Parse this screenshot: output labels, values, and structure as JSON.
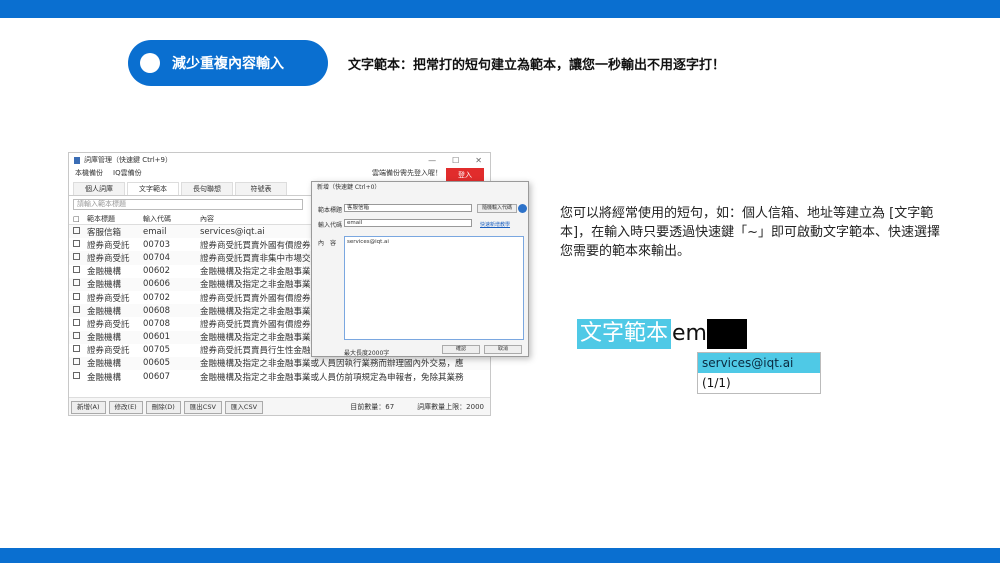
{
  "header": {
    "pill_label": "減少重複內容輸入",
    "headline": "文字範本：把常打的短句建立為範本，讓您一秒輸出不用逐字打！"
  },
  "description": "您可以將經常使用的短句，如：個人信箱、地址等建立為 [文字範本]，在輸入時只要透過快速鍵「~」即可啟動文字範本、快速選擇您需要的範本來輸出。",
  "main_window": {
    "title": "詞庫管理（快速鍵 Ctrl+9）",
    "menu": [
      "本機備份",
      "IQ雲備份"
    ],
    "notice": "雲端備份需先登入喔！",
    "login_label": "登入",
    "tabs": [
      "個人詞庫",
      "文字範本",
      "長句聯想",
      "符號表"
    ],
    "search_placeholder": "請輸入範本標題",
    "columns": [
      "範本標題",
      "輸入代碼",
      "內容"
    ],
    "rows": [
      {
        "title": "客服信箱",
        "code": "email",
        "content": "services@iqt.ai"
      },
      {
        "title": "證券商受託",
        "code": "00703",
        "content": "證券商受託買賣外國有價證券"
      },
      {
        "title": "證券商受託",
        "code": "00704",
        "content": "證券商受託買賣非集中市場交易"
      },
      {
        "title": "金融機構",
        "code": "00602",
        "content": "金融機構及指定之非金融事業"
      },
      {
        "title": "金融機構",
        "code": "00606",
        "content": "金融機構及指定之非金融事業"
      },
      {
        "title": "證券商受託",
        "code": "00702",
        "content": "證券商受託買賣外國有價證券"
      },
      {
        "title": "金融機構",
        "code": "00608",
        "content": "金融機構及指定之非金融事業"
      },
      {
        "title": "證券商受託",
        "code": "00708",
        "content": "證券商受託買賣外國有價證券"
      },
      {
        "title": "金融機構",
        "code": "00601",
        "content": "金融機構及指定之非金融事業"
      },
      {
        "title": "證券商受託",
        "code": "00705",
        "content": "證券商受託買賣員行生性金融"
      },
      {
        "title": "金融機構",
        "code": "00605",
        "content": "金融機構及指定之非金融事業或人員因執行業務而辦理國內外交易，應"
      },
      {
        "title": "金融機構",
        "code": "00607",
        "content": "金融機構及指定之非金融事業或人員仿前項規定為申報者，免除其業務"
      }
    ],
    "toolbar": {
      "buttons": [
        "新增(A)",
        "修改(E)",
        "刪除(D)",
        "匯出CSV",
        "匯入CSV"
      ],
      "count": "目前數量：67",
      "limit": "詞庫數量上限：2000"
    }
  },
  "dialog": {
    "title": "新增（快速鍵 Ctrl+0）",
    "label_title": "範本標題",
    "value_title": "客服信箱",
    "label_code": "輸入代碼",
    "value_code": "email",
    "label_content": "內　容",
    "value_content": "services@iqt.ai",
    "btn_auto": "隨機輸入代碼",
    "link": "快速新增教學",
    "char_limit": "最大長度2000字",
    "ok": "確認",
    "cancel": "取消"
  },
  "autocomplete": {
    "selected_text": "文字範本",
    "typed": "em",
    "suggestion": "services@iqt.ai",
    "pager": "(1/1)"
  },
  "colors": {
    "brand_blue": "#0a6fd0",
    "login_red": "#e12c2c",
    "highlight_cyan": "#4fc9e6"
  }
}
